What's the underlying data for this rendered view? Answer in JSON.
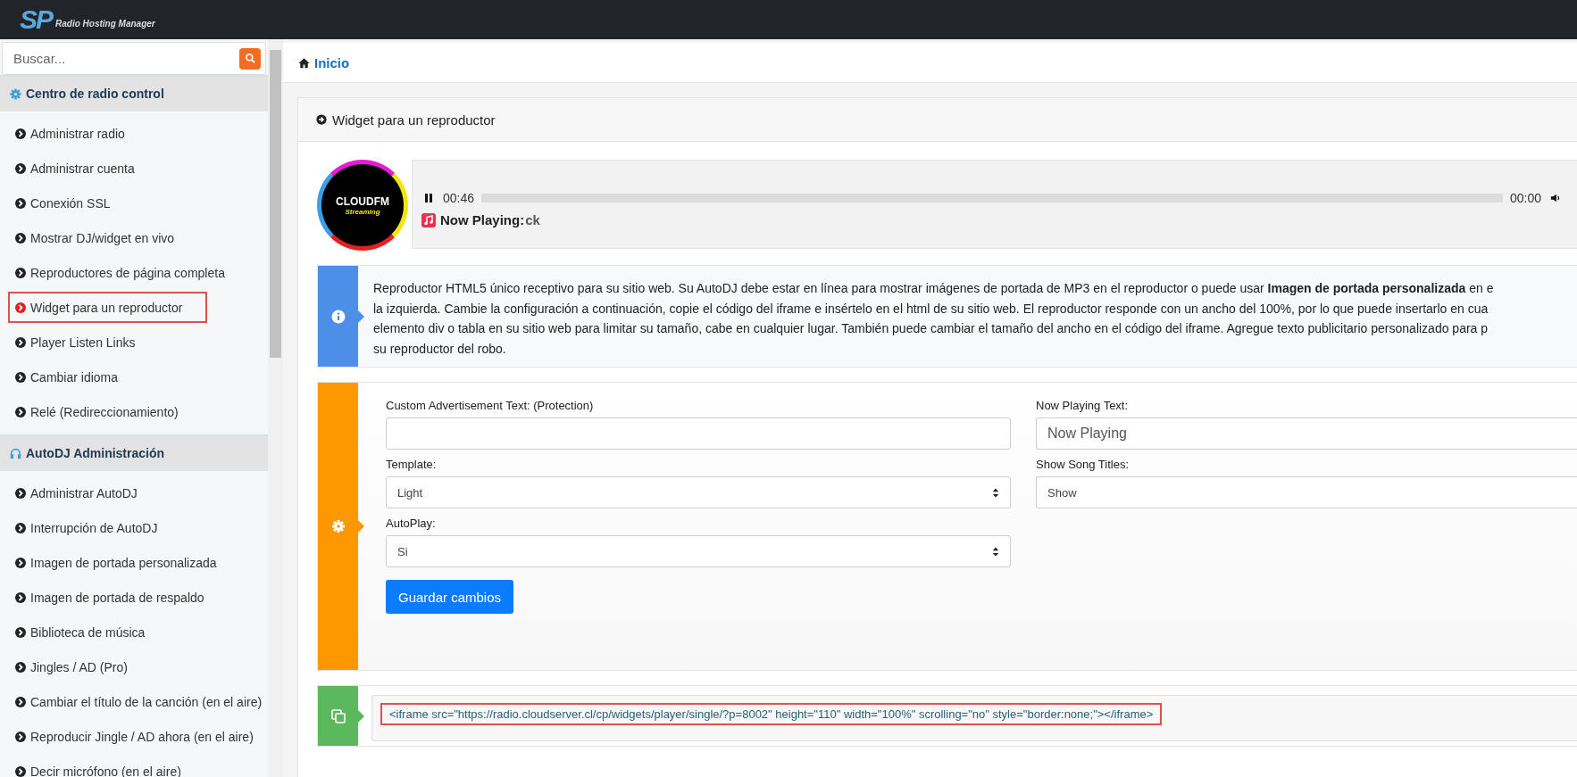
{
  "header": {
    "logo_mark": "SP",
    "logo_text": "Radio Hosting Manager"
  },
  "sidebar": {
    "search": {
      "placeholder": "Buscar..."
    },
    "sections": [
      {
        "title": "Centro de radio control",
        "items": [
          {
            "label": "Administrar radio",
            "selected": false
          },
          {
            "label": "Administrar cuenta",
            "selected": false
          },
          {
            "label": "Conexión SSL",
            "selected": false
          },
          {
            "label": "Mostrar DJ/widget en vivo",
            "selected": false
          },
          {
            "label": "Reproductores de página completa",
            "selected": false
          },
          {
            "label": "Widget para un reproductor",
            "selected": true
          },
          {
            "label": "Player Listen Links",
            "selected": false
          },
          {
            "label": "Cambiar idioma",
            "selected": false
          },
          {
            "label": "Relé (Redireccionamiento)",
            "selected": false
          }
        ]
      },
      {
        "title": "AutoDJ Administración",
        "items": [
          {
            "label": "Administrar AutoDJ",
            "selected": false
          },
          {
            "label": "Interrupción de AutoDJ",
            "selected": false
          },
          {
            "label": "Imagen de portada personalizada",
            "selected": false
          },
          {
            "label": "Imagen de portada de respaldo",
            "selected": false
          },
          {
            "label": "Biblioteca de música",
            "selected": false
          },
          {
            "label": "Jingles / AD (Pro)",
            "selected": false
          },
          {
            "label": "Cambiar el título de la canción (en el aire)",
            "selected": false
          },
          {
            "label": "Reproducir Jingle / AD ahora (en el aire)",
            "selected": false
          },
          {
            "label": "Decir micrófono (en el aire)",
            "selected": false
          }
        ]
      }
    ]
  },
  "breadcrumb": {
    "label": "Inicio"
  },
  "card": {
    "title": "Widget para un reproductor",
    "player": {
      "logo_title": "CLOUDFM",
      "logo_subtitle": "Streaming",
      "playing": true,
      "elapsed": "00:46",
      "duration": "00:00",
      "now_playing_label": "Now Playing:",
      "track": "ck"
    },
    "info": {
      "lines": [
        "Reproductor HTML5 único receptivo para su sitio web. Su AutoDJ debe estar en línea para mostrar imágenes de portada de MP3 en el reproductor o puede usar **Imagen de portada personalizada** en e",
        "la izquierda. Cambie la configuración a continuación, copie el código del iframe e insértelo en el html de su sitio web. El reproductor responde con un ancho del 100%, por lo que puede insertarlo en cua",
        "elemento div o tabla en su sitio web para limitar su tamaño, cabe en cualquier lugar. También puede cambiar el tamaño del ancho en el código del iframe. Agregue texto publicitario personalizado para p",
        "su reproductor del robo."
      ]
    },
    "form": {
      "fields": [
        {
          "kind": "text",
          "label": "Custom Advertisement Text: (Protection)"
        },
        {
          "kind": "text",
          "label": "Now Playing Text:",
          "value": "Now Playing"
        },
        {
          "kind": "select",
          "label": "Template:",
          "value": "Light"
        },
        {
          "kind": "select",
          "label": "Show Song Titles:",
          "value": "Show"
        },
        {
          "kind": "select",
          "label": "AutoPlay:",
          "value": "Si"
        }
      ],
      "save_button": "Guardar cambios"
    },
    "code": {
      "text": "<iframe src=\"https://radio.cloudserver.cl/cp/widgets/player/single/?p=8002\" height=\"110\" width=\"100%\" scrolling=\"no\" style=\"border:none;\"></iframe>"
    }
  }
}
